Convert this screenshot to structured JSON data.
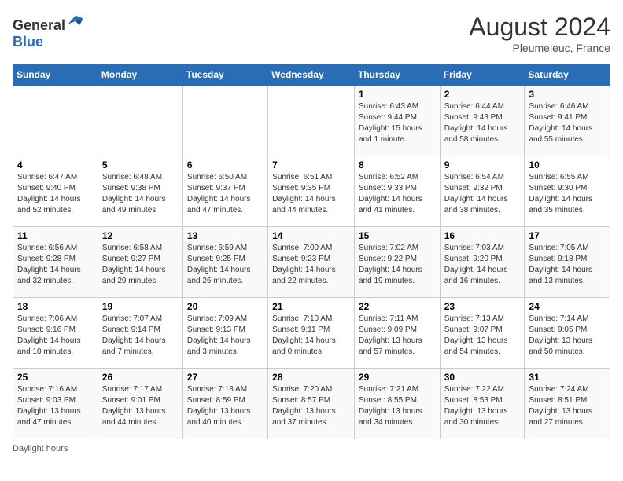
{
  "header": {
    "logo_general": "General",
    "logo_blue": "Blue",
    "month_year": "August 2024",
    "location": "Pleumeleuc, France"
  },
  "days_of_week": [
    "Sunday",
    "Monday",
    "Tuesday",
    "Wednesday",
    "Thursday",
    "Friday",
    "Saturday"
  ],
  "footnote": "Daylight hours",
  "weeks": [
    [
      {
        "day": "",
        "info": ""
      },
      {
        "day": "",
        "info": ""
      },
      {
        "day": "",
        "info": ""
      },
      {
        "day": "",
        "info": ""
      },
      {
        "day": "1",
        "info": "Sunrise: 6:43 AM\nSunset: 9:44 PM\nDaylight: 15 hours and 1 minute."
      },
      {
        "day": "2",
        "info": "Sunrise: 6:44 AM\nSunset: 9:43 PM\nDaylight: 14 hours and 58 minutes."
      },
      {
        "day": "3",
        "info": "Sunrise: 6:46 AM\nSunset: 9:41 PM\nDaylight: 14 hours and 55 minutes."
      }
    ],
    [
      {
        "day": "4",
        "info": "Sunrise: 6:47 AM\nSunset: 9:40 PM\nDaylight: 14 hours and 52 minutes."
      },
      {
        "day": "5",
        "info": "Sunrise: 6:48 AM\nSunset: 9:38 PM\nDaylight: 14 hours and 49 minutes."
      },
      {
        "day": "6",
        "info": "Sunrise: 6:50 AM\nSunset: 9:37 PM\nDaylight: 14 hours and 47 minutes."
      },
      {
        "day": "7",
        "info": "Sunrise: 6:51 AM\nSunset: 9:35 PM\nDaylight: 14 hours and 44 minutes."
      },
      {
        "day": "8",
        "info": "Sunrise: 6:52 AM\nSunset: 9:33 PM\nDaylight: 14 hours and 41 minutes."
      },
      {
        "day": "9",
        "info": "Sunrise: 6:54 AM\nSunset: 9:32 PM\nDaylight: 14 hours and 38 minutes."
      },
      {
        "day": "10",
        "info": "Sunrise: 6:55 AM\nSunset: 9:30 PM\nDaylight: 14 hours and 35 minutes."
      }
    ],
    [
      {
        "day": "11",
        "info": "Sunrise: 6:56 AM\nSunset: 9:28 PM\nDaylight: 14 hours and 32 minutes."
      },
      {
        "day": "12",
        "info": "Sunrise: 6:58 AM\nSunset: 9:27 PM\nDaylight: 14 hours and 29 minutes."
      },
      {
        "day": "13",
        "info": "Sunrise: 6:59 AM\nSunset: 9:25 PM\nDaylight: 14 hours and 26 minutes."
      },
      {
        "day": "14",
        "info": "Sunrise: 7:00 AM\nSunset: 9:23 PM\nDaylight: 14 hours and 22 minutes."
      },
      {
        "day": "15",
        "info": "Sunrise: 7:02 AM\nSunset: 9:22 PM\nDaylight: 14 hours and 19 minutes."
      },
      {
        "day": "16",
        "info": "Sunrise: 7:03 AM\nSunset: 9:20 PM\nDaylight: 14 hours and 16 minutes."
      },
      {
        "day": "17",
        "info": "Sunrise: 7:05 AM\nSunset: 9:18 PM\nDaylight: 14 hours and 13 minutes."
      }
    ],
    [
      {
        "day": "18",
        "info": "Sunrise: 7:06 AM\nSunset: 9:16 PM\nDaylight: 14 hours and 10 minutes."
      },
      {
        "day": "19",
        "info": "Sunrise: 7:07 AM\nSunset: 9:14 PM\nDaylight: 14 hours and 7 minutes."
      },
      {
        "day": "20",
        "info": "Sunrise: 7:09 AM\nSunset: 9:13 PM\nDaylight: 14 hours and 3 minutes."
      },
      {
        "day": "21",
        "info": "Sunrise: 7:10 AM\nSunset: 9:11 PM\nDaylight: 14 hours and 0 minutes."
      },
      {
        "day": "22",
        "info": "Sunrise: 7:11 AM\nSunset: 9:09 PM\nDaylight: 13 hours and 57 minutes."
      },
      {
        "day": "23",
        "info": "Sunrise: 7:13 AM\nSunset: 9:07 PM\nDaylight: 13 hours and 54 minutes."
      },
      {
        "day": "24",
        "info": "Sunrise: 7:14 AM\nSunset: 9:05 PM\nDaylight: 13 hours and 50 minutes."
      }
    ],
    [
      {
        "day": "25",
        "info": "Sunrise: 7:16 AM\nSunset: 9:03 PM\nDaylight: 13 hours and 47 minutes."
      },
      {
        "day": "26",
        "info": "Sunrise: 7:17 AM\nSunset: 9:01 PM\nDaylight: 13 hours and 44 minutes."
      },
      {
        "day": "27",
        "info": "Sunrise: 7:18 AM\nSunset: 8:59 PM\nDaylight: 13 hours and 40 minutes."
      },
      {
        "day": "28",
        "info": "Sunrise: 7:20 AM\nSunset: 8:57 PM\nDaylight: 13 hours and 37 minutes."
      },
      {
        "day": "29",
        "info": "Sunrise: 7:21 AM\nSunset: 8:55 PM\nDaylight: 13 hours and 34 minutes."
      },
      {
        "day": "30",
        "info": "Sunrise: 7:22 AM\nSunset: 8:53 PM\nDaylight: 13 hours and 30 minutes."
      },
      {
        "day": "31",
        "info": "Sunrise: 7:24 AM\nSunset: 8:51 PM\nDaylight: 13 hours and 27 minutes."
      }
    ]
  ]
}
